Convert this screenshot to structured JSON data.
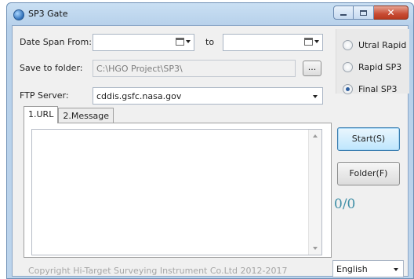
{
  "window": {
    "title": "SP3 Gate",
    "minimize": "minimize",
    "maximize": "maximize",
    "close": "✕"
  },
  "form": {
    "date_from_label": "Date Span From:",
    "date_from_value": "",
    "to_label": "to",
    "date_to_value": "",
    "folder_label": "Save to folder:",
    "folder_value": "C:\\HGO Project\\SP3\\",
    "browse_label": "...",
    "ftp_label": "FTP Server:",
    "ftp_value": "cddis.gsfc.nasa.gov"
  },
  "products": {
    "options": [
      {
        "label": "Utral Rapid",
        "selected": false
      },
      {
        "label": "Rapid SP3",
        "selected": false
      },
      {
        "label": "Final SP3",
        "selected": true
      }
    ]
  },
  "tabs": [
    {
      "label": "1.URL",
      "active": true
    },
    {
      "label": "2.Message",
      "active": false
    }
  ],
  "actions": {
    "start_label": "Start(S)",
    "folder_label": "Folder(F)",
    "progress_text": "0/0"
  },
  "footer": {
    "copyright": "Copyright Hi-Target Surveying Instrument Co.Ltd 2012-2017",
    "language": "English"
  },
  "colors": {
    "accent": "#3e8ea6",
    "title_bar": "#c9dff3",
    "close_button": "#c84d35"
  },
  "icons": [
    "app-icon",
    "calendar-icon",
    "chevron-down-icon",
    "radio-icon"
  ]
}
